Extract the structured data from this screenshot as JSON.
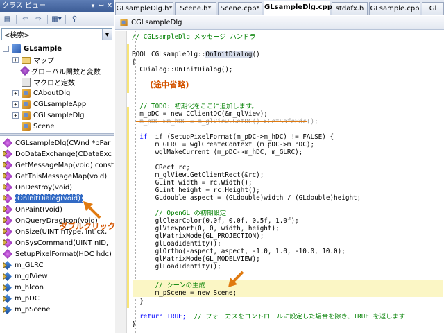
{
  "left_pane": {
    "title": "クラス ビュー",
    "pin_icon": "pin-icon",
    "close_icon": "close-icon",
    "toolbar": {
      "icons": [
        "new-folder-icon",
        "back-icon",
        "forward-icon",
        "settings-icon",
        "grouping-icon"
      ]
    },
    "search": {
      "value": "<検索>"
    },
    "tree": [
      {
        "label": "GLsample",
        "expander": "⊟",
        "icon": "project-icon",
        "bold": true,
        "indent": 0
      },
      {
        "label": "マップ",
        "expander": "⊞",
        "icon": "folder-icon",
        "indent": 1
      },
      {
        "label": "グローバル関数と変数",
        "expander": "",
        "icon": "global-icon",
        "indent": 1
      },
      {
        "label": "マクロと定数",
        "expander": "",
        "icon": "macro-icon",
        "indent": 1
      },
      {
        "label": "CAboutDlg",
        "expander": "⊞",
        "icon": "class-icon",
        "indent": 1
      },
      {
        "label": "CGLsampleApp",
        "expander": "⊞",
        "icon": "class-icon",
        "indent": 1
      },
      {
        "label": "CGLsampleDlg",
        "expander": "⊞",
        "icon": "class-icon",
        "indent": 1
      },
      {
        "label": "Scene",
        "expander": "",
        "icon": "class-icon",
        "indent": 1
      }
    ],
    "members": [
      {
        "label": "CGLsampleDlg(CWnd *pPar",
        "icon": "method-icon"
      },
      {
        "label": "DoDataExchange(CDataExc",
        "icon": "method-icon",
        "lock": true
      },
      {
        "label": "GetMessageMap(void) const",
        "icon": "method-icon",
        "lock": true
      },
      {
        "label": "GetThisMessageMap(void)",
        "icon": "method-icon",
        "lock": true
      },
      {
        "label": "OnDestroy(void)",
        "icon": "method-icon",
        "lock": true
      },
      {
        "label": "OnInitDialog(void)",
        "icon": "method-icon",
        "lock": true,
        "selected": true
      },
      {
        "label": "OnPaint(void)",
        "icon": "method-icon",
        "lock": true
      },
      {
        "label": "OnQueryDragIcon(void)",
        "icon": "method-icon",
        "lock": true
      },
      {
        "label": "OnSize(UINT nType, int cx,",
        "icon": "method-icon",
        "lock": true
      },
      {
        "label": "OnSysCommand(UINT nID,",
        "icon": "method-icon",
        "lock": true
      },
      {
        "label": "SetupPixelFormat(HDC hdc)",
        "icon": "method-icon"
      },
      {
        "label": "m_GLRC",
        "icon": "variable-icon",
        "lock": true
      },
      {
        "label": "m_glView",
        "icon": "variable-icon",
        "lock": true
      },
      {
        "label": "m_hIcon",
        "icon": "variable-icon",
        "lock": true
      },
      {
        "label": "m_pDC",
        "icon": "variable-icon",
        "lock": true
      },
      {
        "label": "m_pScene",
        "icon": "variable-icon",
        "lock": true
      }
    ],
    "annotation": "ダブルクリック"
  },
  "tabs": [
    {
      "label": "GLsampleDlg.h*",
      "active": false
    },
    {
      "label": "Scene.h*",
      "active": false
    },
    {
      "label": "Scene.cpp*",
      "active": false
    },
    {
      "label": "GLsampleDlg.cpp*",
      "active": true
    },
    {
      "label": "stdafx.h",
      "active": false
    },
    {
      "label": "GLsample.cpp",
      "active": false
    }
  ],
  "navbar": {
    "label": "CGLsampleDlg"
  },
  "code": {
    "l1": "// CGLsampleDlg メッセージ ハンドラ",
    "l2a": "BOOL CGLsampleDlg::",
    "l2b": "OnInitDialog",
    "l2c": "()",
    "l3": "{",
    "l4": "  CDialog::OnInitDialog();",
    "l5": "  // TODO: 初期化をここに追加します。",
    "l6": "  m_pDC = new CClientDC(&m_glView);",
    "l7": "  m_pDC->m_hDC = m_glView.GetDC()->GetSafeHdc();",
    "l8": "  if (SetupPixelFormat(m_pDC->m_hDC) != FALSE) {",
    "l9": "      m_GLRC = wglCreateContext (m_pDC->m_hDC);",
    "l10": "      wglMakeCurrent (m_pDC->m_hDC, m_GLRC);",
    "l11": "      CRect rc;",
    "l12": "      m_glView.GetClientRect(&rc);",
    "l13": "      GLint width = rc.Width();",
    "l14": "      GLint height = rc.Height();",
    "l15": "      GLdouble aspect = (GLdouble)width / (GLdouble)height;",
    "l16": "      // OpenGL の初期設定",
    "l17": "      glClearColor(0.0f, 0.0f, 0.5f, 1.0f);",
    "l18": "      glViewport(0, 0, width, height);",
    "l19": "      glMatrixMode(GL_PROJECTION);",
    "l20": "      glLoadIdentity();",
    "l21": "      glOrtho(-aspect, aspect, -1.0, 1.0, -10.0, 10.0);",
    "l22": "      glMatrixMode(GL_MODELVIEW);",
    "l23": "      glLoadIdentity();",
    "l24": "      // シーンの生成",
    "l25": "      m_pScene = new Scene;",
    "l26": "  }",
    "l27a": "  return TRUE;  ",
    "l27b": "// フォーカスをコントロールに設定した場合を除き、TRUE を返します",
    "l28": "}",
    "omitted": "(途中省略)"
  },
  "colors": {
    "accent": "#316ac5",
    "note": "#d35400",
    "keyword": "#0000ff",
    "comment": "#008000",
    "highlight": "#fbf6c5"
  }
}
